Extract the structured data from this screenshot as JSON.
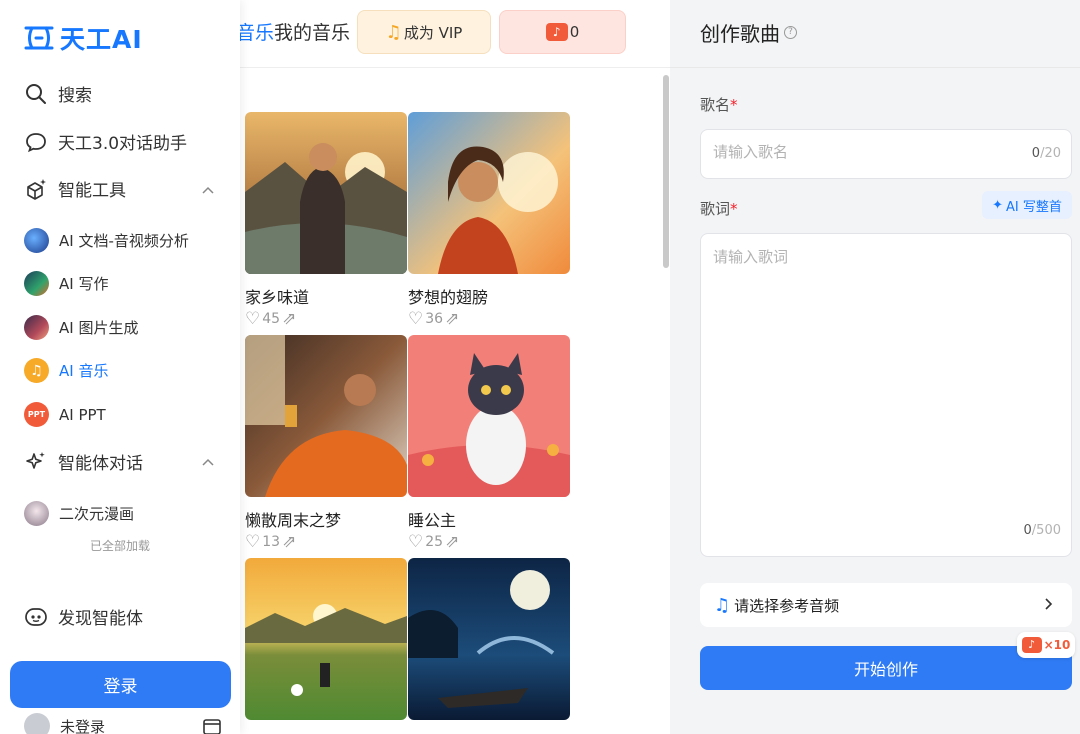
{
  "app": {
    "logo_text": "天工AI"
  },
  "header": {
    "breadcrumb_prefix": "音乐",
    "breadcrumb_current": "我的音乐",
    "vip_label": "成为 VIP",
    "coin_count": "0"
  },
  "sidebar": {
    "search_label": "搜索",
    "chat_label": "天工3.0对话助手",
    "tools_label": "智能工具",
    "tools": [
      {
        "label": "AI 文档-音视频分析",
        "icon": "doc-analysis-avatar"
      },
      {
        "label": "AI 写作",
        "icon": "writing-avatar"
      },
      {
        "label": "AI 图片生成",
        "icon": "image-gen-avatar"
      },
      {
        "label": "AI 音乐",
        "icon": "music-avatar",
        "active": true
      },
      {
        "label": "AI PPT",
        "icon": "ppt-avatar",
        "badge": "PPT"
      }
    ],
    "agent_chat_label": "智能体对话",
    "agents": [
      {
        "label": "二次元漫画",
        "icon": "anime-avatar"
      }
    ],
    "loaded_all": "已全部加载",
    "discover_label": "发现智能体",
    "login_label": "登录",
    "user_label": "未登录"
  },
  "songs": [
    {
      "title": "家乡味道",
      "likes": "45"
    },
    {
      "title": "梦想的翅膀",
      "likes": "36"
    },
    {
      "title": "懒散周末之梦",
      "likes": "13"
    },
    {
      "title": "睡公主",
      "likes": "25"
    },
    {
      "title": "",
      "likes": ""
    },
    {
      "title": "",
      "likes": ""
    }
  ],
  "create": {
    "title": "创作歌曲",
    "song_name_label": "歌名",
    "song_name_placeholder": "请输入歌名",
    "song_name_count": "0",
    "song_name_max": "/20",
    "lyrics_label": "歌词",
    "ai_write_label": "AI 写整首",
    "lyrics_placeholder": "请输入歌词",
    "lyrics_count": "0",
    "lyrics_max": "/500",
    "ref_audio_label": "请选择参考音频",
    "start_label": "开始创作",
    "cost": "×10"
  },
  "colors": {
    "accent": "#1677ff",
    "button": "#2f7bf5",
    "required": "#f5222d",
    "coin": "#f25b3a"
  }
}
